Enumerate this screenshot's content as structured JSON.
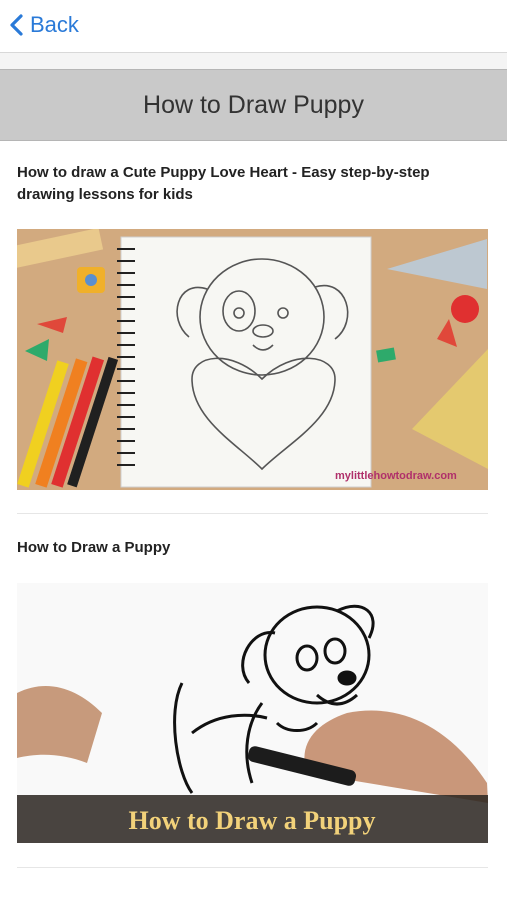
{
  "nav": {
    "back_label": "Back"
  },
  "header": {
    "title": "How to Draw Puppy"
  },
  "videos": [
    {
      "title": "How to draw a Cute Puppy Love Heart - Easy step-by-step drawing lessons for kids",
      "watermark": "mylittlehowtodraw.com"
    },
    {
      "title": "How to Draw a Puppy",
      "caption": "How to Draw a Puppy"
    }
  ],
  "colors": {
    "accent": "#2a7ad8",
    "header_bg": "#c9c9c9",
    "caption_text": "#f2d27a"
  }
}
